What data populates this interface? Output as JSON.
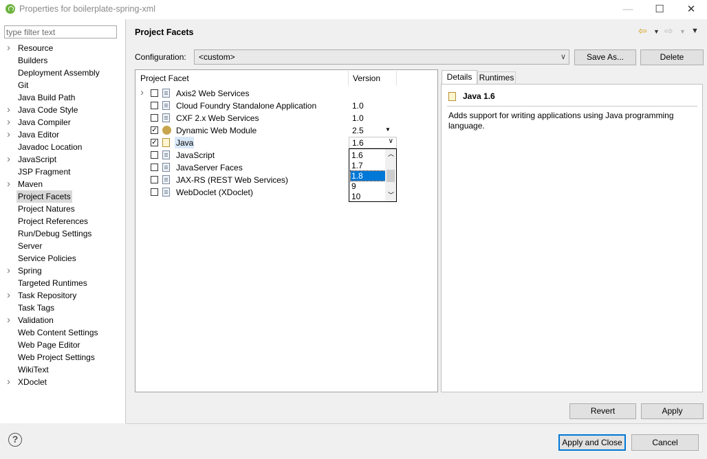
{
  "window": {
    "title": "Properties for boilerplate-spring-xml",
    "minimize": "—",
    "maximize": "☐",
    "close": "✕"
  },
  "filter": {
    "placeholder": "type filter text"
  },
  "tree": [
    {
      "label": "Resource",
      "expandable": true
    },
    {
      "label": "Builders",
      "expandable": false
    },
    {
      "label": "Deployment Assembly",
      "expandable": false
    },
    {
      "label": "Git",
      "expandable": false
    },
    {
      "label": "Java Build Path",
      "expandable": false
    },
    {
      "label": "Java Code Style",
      "expandable": true
    },
    {
      "label": "Java Compiler",
      "expandable": true
    },
    {
      "label": "Java Editor",
      "expandable": true
    },
    {
      "label": "Javadoc Location",
      "expandable": false
    },
    {
      "label": "JavaScript",
      "expandable": true
    },
    {
      "label": "JSP Fragment",
      "expandable": false
    },
    {
      "label": "Maven",
      "expandable": true
    },
    {
      "label": "Project Facets",
      "expandable": false,
      "selected": true
    },
    {
      "label": "Project Natures",
      "expandable": false
    },
    {
      "label": "Project References",
      "expandable": false
    },
    {
      "label": "Run/Debug Settings",
      "expandable": false
    },
    {
      "label": "Server",
      "expandable": false
    },
    {
      "label": "Service Policies",
      "expandable": false
    },
    {
      "label": "Spring",
      "expandable": true
    },
    {
      "label": "Targeted Runtimes",
      "expandable": false
    },
    {
      "label": "Task Repository",
      "expandable": true
    },
    {
      "label": "Task Tags",
      "expandable": false
    },
    {
      "label": "Validation",
      "expandable": true
    },
    {
      "label": "Web Content Settings",
      "expandable": false
    },
    {
      "label": "Web Page Editor",
      "expandable": false
    },
    {
      "label": "Web Project Settings",
      "expandable": false
    },
    {
      "label": "WikiText",
      "expandable": false
    },
    {
      "label": "XDoclet",
      "expandable": true
    }
  ],
  "page": {
    "title": "Project Facets",
    "nav_icons": [
      "back-arrow-icon",
      "dropdown-icon",
      "forward-arrow-icon",
      "dropdown-icon",
      "view-menu-icon"
    ]
  },
  "config": {
    "label": "Configuration:",
    "value": "<custom>",
    "save_as": "Save As...",
    "delete": "Delete"
  },
  "facets": {
    "col_facet": "Project Facet",
    "col_version": "Version",
    "rows": [
      {
        "name": "Axis2 Web Services",
        "version": "",
        "checked": false,
        "expandable": true
      },
      {
        "name": "Cloud Foundry Standalone Application",
        "version": "1.0",
        "checked": false
      },
      {
        "name": "CXF 2.x Web Services",
        "version": "1.0",
        "checked": false
      },
      {
        "name": "Dynamic Web Module",
        "version": "2.5",
        "checked": true
      },
      {
        "name": "Java",
        "version": "1.6",
        "checked": true
      },
      {
        "name": "JavaScript",
        "version": "",
        "checked": false
      },
      {
        "name": "JavaServer Faces",
        "version": "",
        "checked": false
      },
      {
        "name": "JAX-RS (REST Web Services)",
        "version": "",
        "checked": false
      },
      {
        "name": "WebDoclet (XDoclet)",
        "version": "",
        "checked": false
      }
    ]
  },
  "version_dropdown": {
    "current": "1.6",
    "options": [
      "1.6",
      "1.7",
      "1.8",
      "9",
      "10"
    ],
    "highlighted": "1.8"
  },
  "details": {
    "tab_details": "Details",
    "tab_runtimes": "Runtimes",
    "title": "Java 1.6",
    "description": "Adds support for writing applications using Java programming language."
  },
  "buttons": {
    "revert": "Revert",
    "apply": "Apply",
    "apply_close": "Apply and Close",
    "cancel": "Cancel"
  },
  "help": "?"
}
